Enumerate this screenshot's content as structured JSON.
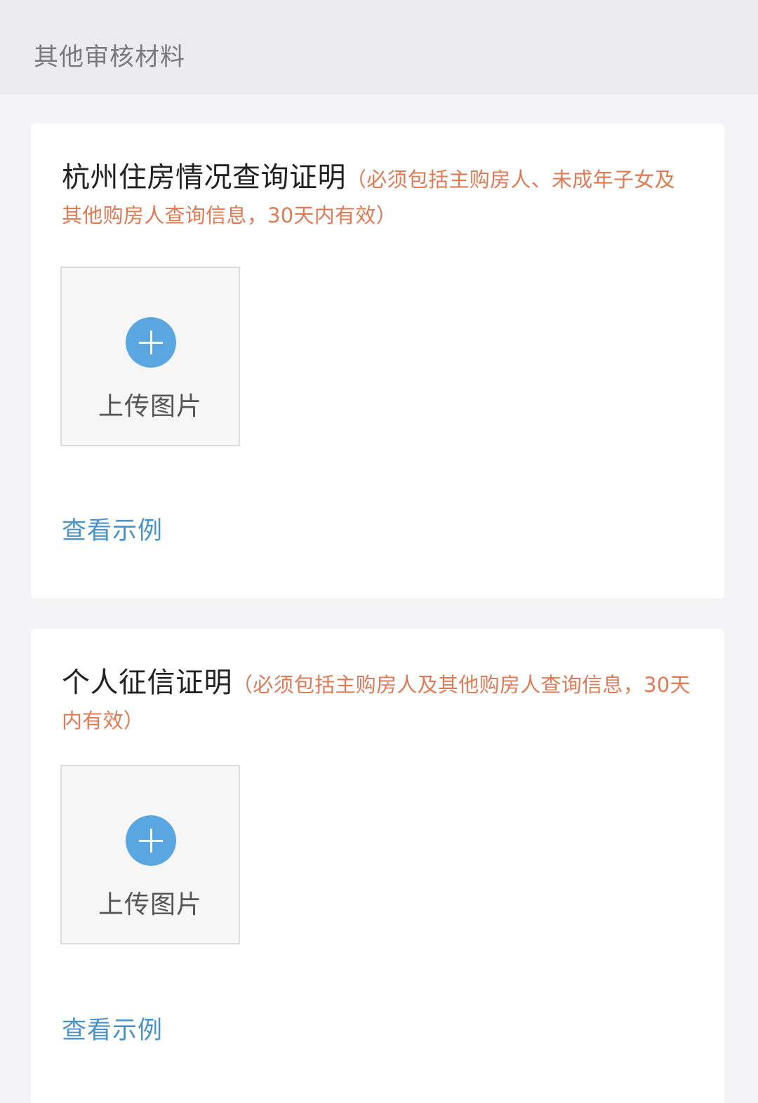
{
  "section": {
    "title": "其他审核材料"
  },
  "documents": [
    {
      "name": "杭州住房情况查询证明",
      "note": "（必须包括主购房人、未成年子女及其他购房人查询信息，30天内有效）",
      "upload_label": "上传图片",
      "example_label": "查看示例"
    },
    {
      "name": "个人征信证明",
      "note": "（必须包括主购房人及其他购房人查询信息，30天内有效）",
      "upload_label": "上传图片",
      "example_label": "查看示例"
    }
  ],
  "colors": {
    "note_orange": "#e07a55",
    "link_blue": "#4a93c9",
    "plus_blue": "#5aa6e0"
  },
  "icons": {
    "upload": "plus-circle-icon"
  }
}
